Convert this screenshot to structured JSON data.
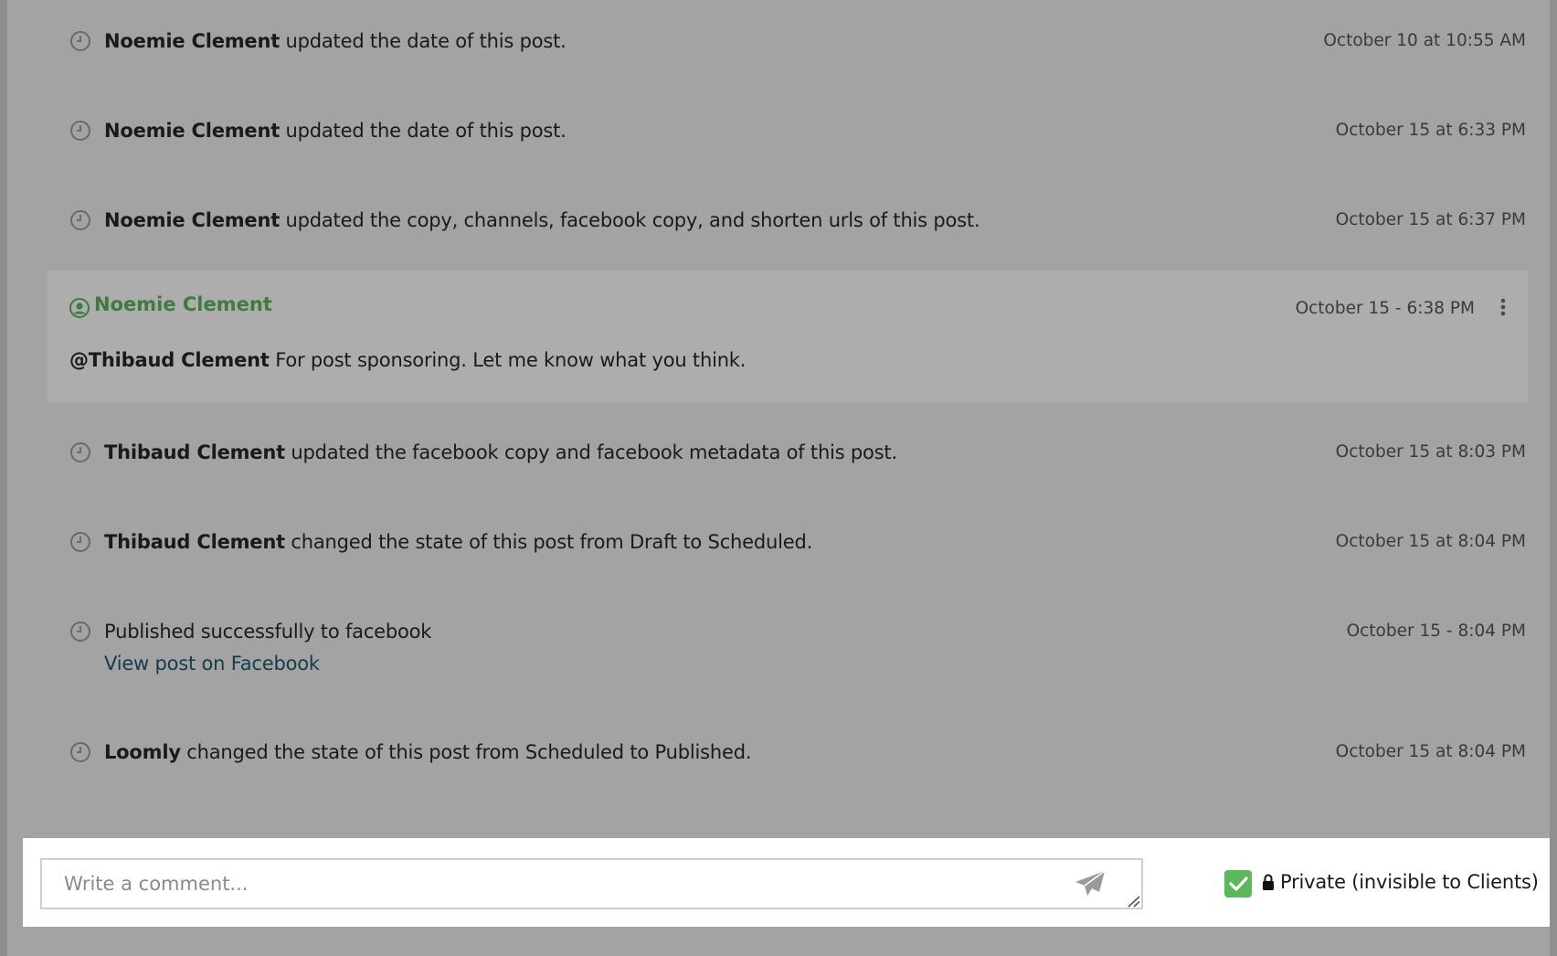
{
  "activities_before": [
    {
      "actor": "Noemie Clement",
      "action": " updated the date of this post.",
      "time": "October 10 at 10:55 AM"
    },
    {
      "actor": "Noemie Clement",
      "action": " updated the date of this post.",
      "time": "October 15 at 6:33 PM"
    },
    {
      "actor": "Noemie Clement",
      "action": " updated the copy, channels, facebook copy, and shorten urls of this post.",
      "time": "October 15 at 6:37 PM"
    }
  ],
  "comment": {
    "author": "Noemie Clement",
    "time": "October 15 - 6:38 PM",
    "mention": "@Thibaud Clement",
    "text": " For post sponsoring. Let me know what you think."
  },
  "activities_after": [
    {
      "actor": "Thibaud Clement",
      "action": " updated the facebook copy and facebook metadata of this post.",
      "time": "October 15 at 8:03 PM"
    },
    {
      "actor": "Thibaud Clement",
      "action": " changed the state of this post from Draft to Scheduled.",
      "time": "October 15 at 8:04 PM"
    }
  ],
  "published": {
    "text": "Published successfully to facebook",
    "link": "View post on Facebook",
    "time": "October 15 - 8:04 PM"
  },
  "final_activity": {
    "actor": "Loomly",
    "action": " changed the state of this post from Scheduled to Published.",
    "time": "October 15 at 8:04 PM"
  },
  "composer": {
    "placeholder": "Write a comment...",
    "private_label": "Private (invisible to Clients)",
    "private_checked": true
  },
  "colors": {
    "overlay_bg": "#a3a3a3",
    "comment_bg": "#adadad",
    "author_green": "#3f7a3f",
    "check_green": "#5cb85c",
    "link_blue": "#123d4a"
  }
}
